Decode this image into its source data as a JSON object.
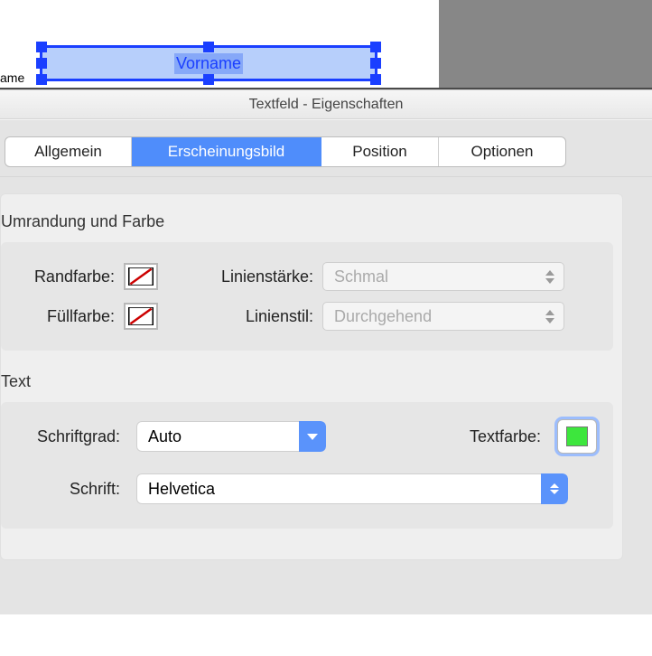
{
  "canvas": {
    "left_field_label": "ame",
    "selected_field_label": "Vorname"
  },
  "window": {
    "title": "Textfeld - Eigenschaften"
  },
  "tabs": {
    "general": "Allgemein",
    "appearance": "Erscheinungsbild",
    "position": "Position",
    "options": "Optionen"
  },
  "groups": {
    "border_title": "Umrandung und Farbe",
    "text_title": "Text"
  },
  "labels": {
    "border_color": "Randfarbe:",
    "line_width": "Linienstärke:",
    "fill_color": "Füllfarbe:",
    "line_style": "Linienstil:",
    "font_size": "Schriftgrad:",
    "text_color": "Textfarbe:",
    "font": "Schrift:"
  },
  "values": {
    "line_width": "Schmal",
    "line_style": "Durchgehend",
    "font_size": "Auto",
    "font": "Helvetica",
    "text_color_hex": "#3de63d"
  }
}
